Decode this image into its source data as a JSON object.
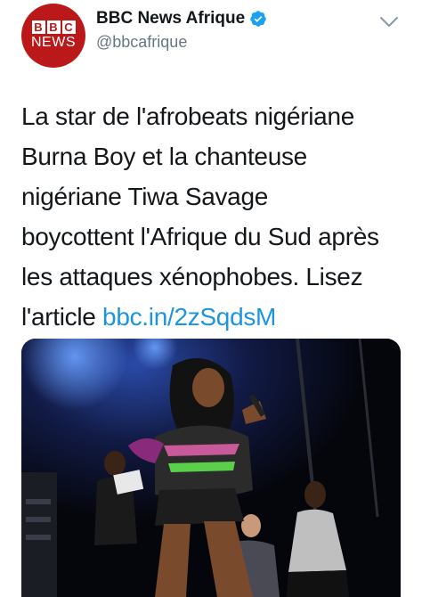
{
  "account": {
    "avatar_logo": "BBC NEWS",
    "logo_letters": [
      "B",
      "B",
      "C"
    ],
    "logo_word": "NEWS",
    "display_name": "BBC News Afrique",
    "handle": "@bbcafrique",
    "verified_icon": "verified-badge-icon",
    "menu_icon": "chevron-down-icon"
  },
  "tweet": {
    "lines": [
      "La star de l'afrobeats nigériane",
      "Burna Boy et la chanteuse",
      "nigériane Tiwa Savage",
      "boycottent l'Afrique du Sud après",
      "les attaques xénophobes. Lisez"
    ],
    "last_line_prefix": "l'article ",
    "link_text": "bbc.in/2zSqdsM"
  },
  "media": {
    "type": "photo"
  },
  "colors": {
    "brand_red": "#bb1919",
    "verified_blue": "#1da1f2",
    "link_blue": "#1b95e0",
    "handle_gray": "#657786",
    "text": "#14171a"
  }
}
